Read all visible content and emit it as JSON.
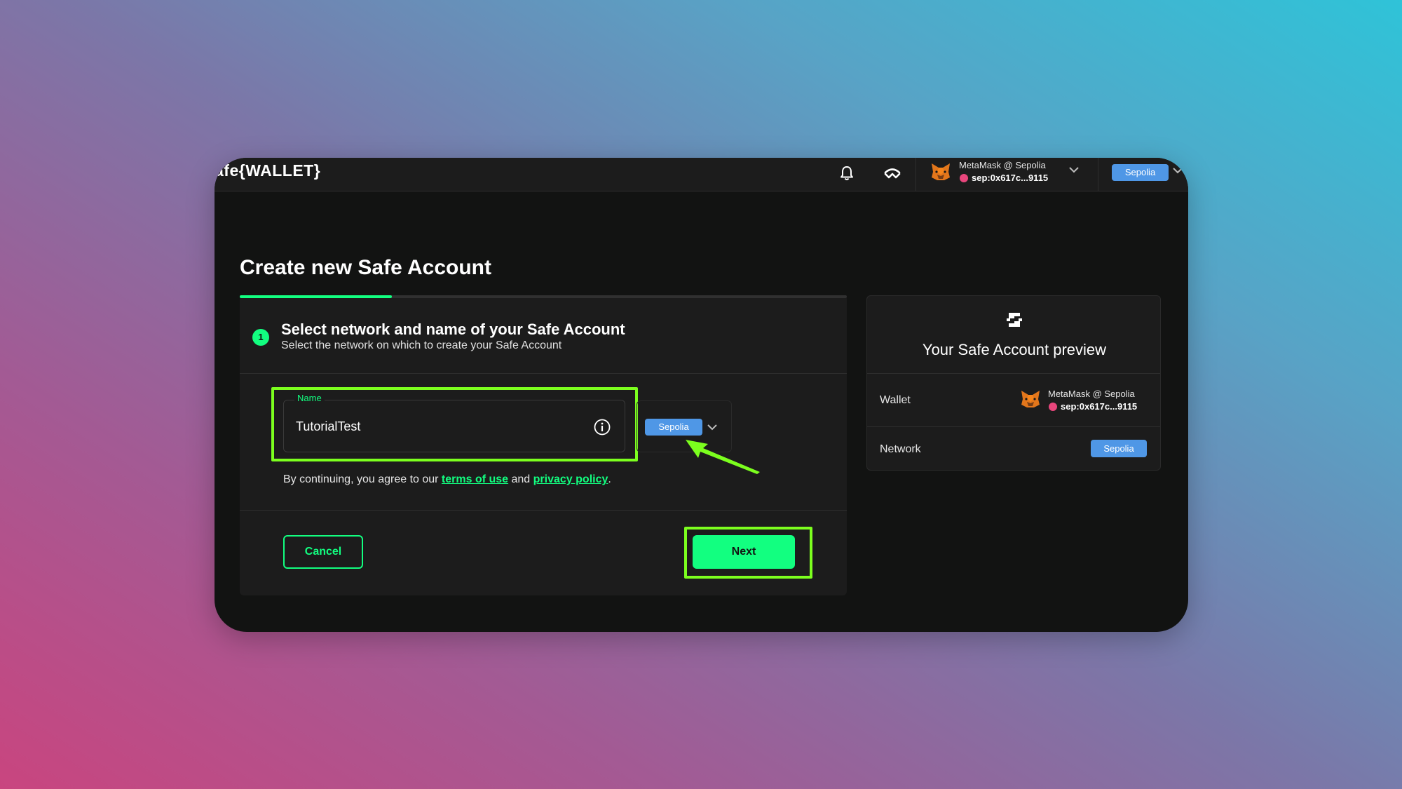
{
  "header": {
    "logo": "afe{WALLET}",
    "account_name": "MetaMask @ Sepolia",
    "account_address": "sep:0x617c...9115",
    "network_chip": "Sepolia"
  },
  "page": {
    "title": "Create new Safe Account"
  },
  "step": {
    "number": "1",
    "title": "Select network and name of your Safe Account",
    "subtitle": "Select the network on which to create your Safe Account",
    "progress": 0.25
  },
  "form": {
    "name_label": "Name",
    "name_value": "TutorialTest",
    "network_chip": "Sepolia",
    "agree_prefix": "By continuing, you agree to our ",
    "terms_link": "terms of use",
    "agree_mid": " and ",
    "privacy_link": "privacy policy",
    "agree_suffix": "."
  },
  "actions": {
    "cancel_label": "Cancel",
    "next_label": "Next"
  },
  "preview": {
    "title": "Your Safe Account preview",
    "wallet_label": "Wallet",
    "wallet_name": "MetaMask @ Sepolia",
    "wallet_address": "sep:0x617c...9115",
    "network_label": "Network",
    "network_chip": "Sepolia"
  },
  "colors": {
    "accent": "#12ff80",
    "highlight": "#7cff1e",
    "network_chip": "#4f97e6",
    "window_bg": "#121312",
    "card_bg": "#1c1c1c"
  }
}
